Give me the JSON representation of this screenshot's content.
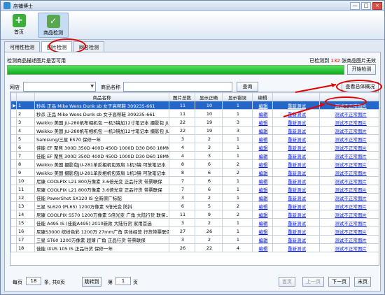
{
  "window": {
    "title": "店铺博士"
  },
  "toolbar": {
    "home_label": "首页",
    "check_label": "商品检测"
  },
  "tabs": [
    {
      "label": "可用性检测"
    },
    {
      "label": "图片检测"
    },
    {
      "label": "网名检测"
    }
  ],
  "detection": {
    "description": "检测商品描述图片是否可用",
    "detected_prefix": "已检测到",
    "detected_count": "132",
    "detected_suffix": "张商品图片无效",
    "progress_fraction": 1,
    "start_button": "开始检测"
  },
  "filters": {
    "shop_label": "网店",
    "name_label": "商品名称",
    "query_button": "查询",
    "overview_button": "查看总体概况"
  },
  "table": {
    "headers": [
      "",
      "",
      "商品名称",
      "图片总数",
      "显示正确",
      "显示错误",
      "编辑",
      "",
      ""
    ],
    "rows": [
      [
        "▶",
        "1",
        "秒杀 正品 Mike Wens Dunk sb 女子高帮鞋 309235-661",
        "11",
        "10",
        "1",
        "编辑",
        "重新测试",
        "测试不正常图片"
      ],
      [
        "",
        "2",
        "秒杀 正品 Mike Wens Dunk sb 女子高帮鞋 309235-661",
        "11",
        "10",
        "1",
        "编辑",
        "重新测试",
        "测试不正常图片"
      ],
      [
        "",
        "3",
        "Weikko 美国 JU-280帆布相机包 一机3镜加12寸笔记本 摄影包 JU280",
        "22",
        "19",
        "3",
        "编辑",
        "重新测试",
        "测试不正常图片"
      ],
      [
        "",
        "4",
        "Weikko 美国 JU-280帆布相机包 一机3镜加12寸笔记本 摄影包 JU280",
        "22",
        "19",
        "3",
        "编辑",
        "重新测试",
        "测试不正常图片"
      ],
      [
        "",
        "5",
        "Samsung/三星 ES70 保修一年",
        "3",
        "2",
        "1",
        "编辑",
        "重新测试",
        "测试不正常图片"
      ],
      [
        "",
        "6",
        "佳能 EF 聚焦 300D 350D 400D 450D 1000D D30 D60 18MM",
        "4",
        "3",
        "1",
        "编辑",
        "重新测试",
        "测试不正常图片"
      ],
      [
        "",
        "7",
        "佳能 EF 聚焦 300D 350D 400D 450D 1000D D30 D60 18MM",
        "4",
        "3",
        "1",
        "编辑",
        "重新测试",
        "测试不正常图片"
      ],
      [
        "",
        "8",
        "Weikko 美国 摄影包JU-281单反相机包双肩 1机3镜 可放笔记本",
        "8",
        "6",
        "2",
        "编辑",
        "重新测试",
        "测试不正常图片"
      ],
      [
        "",
        "9",
        "Weikko 美国 摄影包JU-281单反相机包双肩 1机3镜 可放笔记本",
        "8",
        "6",
        "2",
        "编辑",
        "重新测试",
        "测试不正常图片"
      ],
      [
        "",
        "10",
        "尼康 COOLPIX L21 800万像素 3.6倍光变 正品行货 带票联保",
        "7",
        "6",
        "1",
        "编辑",
        "重新测试",
        "测试不正常图片"
      ],
      [
        "",
        "11",
        "尼康 COOLPIX L21 800万像素 3.6倍光变 正品行货 带票联保",
        "7",
        "6",
        "1",
        "编辑",
        "重新测试",
        "测试不正常图片"
      ],
      [
        "",
        "12",
        "佳能 PowerShot SX120 IS 全新原厂标配",
        "3",
        "2",
        "1",
        "编辑",
        "重新测试",
        "测试不正常图片"
      ],
      [
        "",
        "13",
        "三星 SL620 (PL65) 1200万像素 5倍光变 防抖",
        "6",
        "5",
        "2",
        "编辑",
        "重新测试",
        "测试不正常图片"
      ],
      [
        "",
        "14",
        "尼康 COOLPIX S570 1200万像素 5倍光变 广角 大陆行货 联保...",
        "11",
        "9",
        "2",
        "编辑",
        "重新测试",
        "测试不正常图片"
      ],
      [
        "",
        "15",
        "佳能 A495 IS (佳能A495) 2010新款 大陆行货 家用首选",
        "3",
        "2",
        "1",
        "编辑",
        "重新测试",
        "测试不正常图片"
      ],
      [
        "",
        "16",
        "尼康S3000 缤纷色彩 1200万 27mm广角 实体经营 行货带票联保",
        "27",
        "26",
        "1",
        "编辑",
        "重新测试",
        "测试不正常图片"
      ],
      [
        "",
        "17",
        "三星 ST60 1200万像素 超薄 广角 正品行货 带票联保",
        "3",
        "2",
        "1",
        "编辑",
        "重新测试",
        "测试不正常图片"
      ],
      [
        "",
        "18",
        "佳能 IXUS 105 IS 正品行货 保修一年",
        "26",
        "22",
        "4",
        "编辑",
        "重新测试",
        "测试不正常图片"
      ]
    ]
  },
  "pager": {
    "per_page_label": "每页",
    "per_page_value": "18",
    "total_label": "条, 共8页",
    "jump_button": "跳转到",
    "page_label": "第",
    "page_value": "1",
    "page_suffix": "页",
    "first_button": "首页",
    "prev_button": "上一页",
    "next_button": "下一页",
    "last_button": "末页"
  }
}
